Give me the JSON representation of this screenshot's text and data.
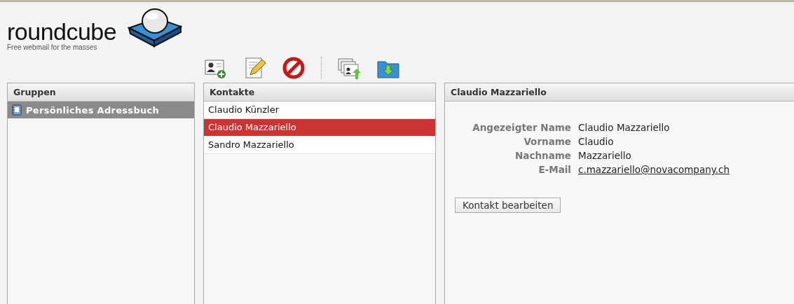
{
  "logo": {
    "name": "roundcube",
    "tagline": "Free webmail for the masses"
  },
  "toolbar": [
    {
      "kind": "add-contact"
    },
    {
      "kind": "edit"
    },
    {
      "kind": "delete"
    },
    {
      "kind": "separator"
    },
    {
      "kind": "import"
    },
    {
      "kind": "export"
    }
  ],
  "groups": {
    "title": "Gruppen",
    "items": [
      {
        "label": "Persönliches Adressbuch",
        "selected": true
      }
    ]
  },
  "contacts": {
    "title": "Kontakte",
    "items": [
      {
        "label": "Claudio Künzler",
        "selected": false
      },
      {
        "label": "Claudio Mazzariello",
        "selected": true
      },
      {
        "label": "Sandro Mazzariello",
        "selected": false
      }
    ]
  },
  "detail": {
    "title": "Claudio Mazzariello",
    "fields": [
      {
        "label": "Angezeigter Name",
        "value": "Claudio Mazzariello",
        "kind": "text"
      },
      {
        "label": "Vorname",
        "value": "Claudio",
        "kind": "text"
      },
      {
        "label": "Nachname",
        "value": "Mazzariello",
        "kind": "text"
      },
      {
        "label": "E-Mail",
        "value": "c.mazzariello@novacompany.ch",
        "kind": "link"
      }
    ],
    "button": "Kontakt bearbeiten"
  }
}
